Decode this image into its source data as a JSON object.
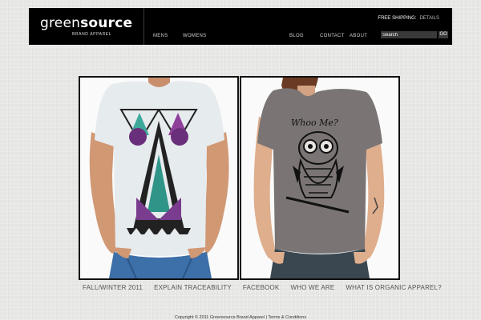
{
  "brand": {
    "name_part1": "green",
    "name_part2": "source",
    "tagline": "BRAND APPAREL"
  },
  "nav": {
    "left": [
      "MENS",
      "WOMENS"
    ],
    "right": [
      "BLOG",
      "CONTACT",
      "ABOUT"
    ]
  },
  "shipping": {
    "label": "FREE SHIPPING:",
    "link": "DETAILS"
  },
  "search": {
    "placeholder": "Search",
    "button": "GO"
  },
  "products": {
    "womens_shirt_text": "Whoo Me?"
  },
  "bottom_links": [
    "FALL/WINTER 2011",
    "EXPLAIN TRACEABILITY",
    "FACEBOOK",
    "WHO WE ARE",
    "WHAT IS ORGANIC APPAREL?"
  ],
  "footer": {
    "text": "Copyright © 2011 Greensource Brand Apparel  |  Terms & Conditions"
  },
  "colors": {
    "header_bg": "#000000",
    "page_bg": "#e9e9e7",
    "search_bg": "#3a3a3a"
  }
}
